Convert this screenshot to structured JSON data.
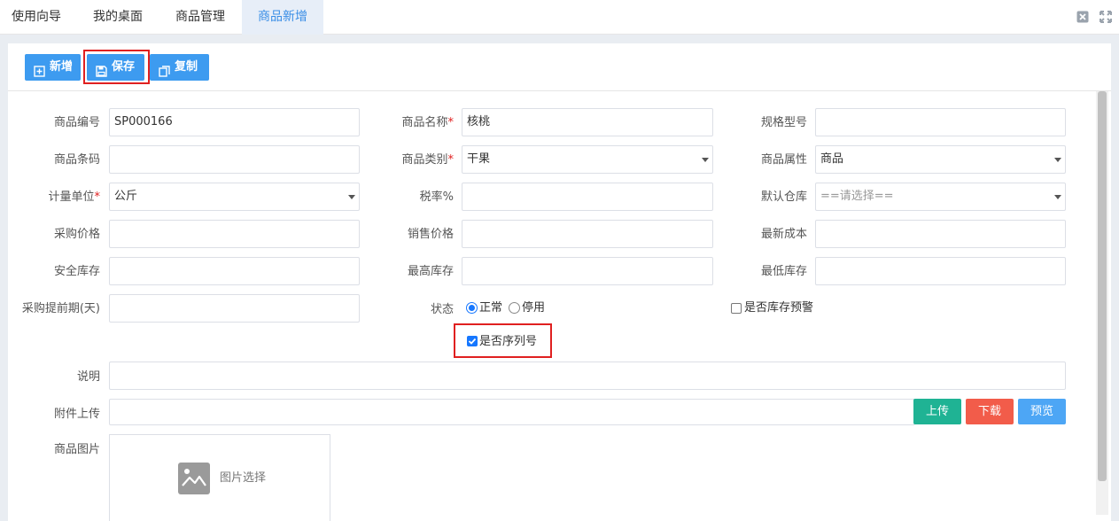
{
  "tabs": [
    {
      "label": "使用向导",
      "active": false
    },
    {
      "label": "我的桌面",
      "active": false
    },
    {
      "label": "商品管理",
      "active": false
    },
    {
      "label": "商品新增",
      "active": true
    }
  ],
  "toolbar": {
    "add_label": "新增",
    "save_label": "保存",
    "copy_label": "复制"
  },
  "form": {
    "code_label": "商品编号",
    "code_value": "SP000166",
    "name_label": "商品名称",
    "name_value": "核桃",
    "spec_label": "规格型号",
    "spec_value": "",
    "barcode_label": "商品条码",
    "barcode_value": "",
    "category_label": "商品类别",
    "category_value": "干果",
    "attr_label": "商品属性",
    "attr_value": "商品",
    "unit_label": "计量单位",
    "unit_value": "公斤",
    "tax_label": "税率%",
    "tax_value": "",
    "warehouse_label": "默认仓库",
    "warehouse_placeholder": "==请选择==",
    "purchase_price_label": "采购价格",
    "purchase_price_value": "",
    "sale_price_label": "销售价格",
    "sale_price_value": "",
    "latest_cost_label": "最新成本",
    "latest_cost_value": "",
    "safe_stock_label": "安全库存",
    "safe_stock_value": "",
    "max_stock_label": "最高库存",
    "max_stock_value": "",
    "min_stock_label": "最低库存",
    "min_stock_value": "",
    "lead_time_label": "采购提前期(天)",
    "lead_time_value": "",
    "status_label": "状态",
    "status_options": [
      "正常",
      "停用"
    ],
    "status_selected": "正常",
    "stock_warning_label": "是否库存预警",
    "stock_warning_checked": false,
    "serial_label": "是否序列号",
    "serial_checked": true,
    "desc_label": "说明",
    "desc_value": "",
    "attach_label": "附件上传",
    "attach_value": "",
    "upload_label": "上传",
    "download_label": "下载",
    "preview_label": "预览",
    "image_label": "商品图片",
    "image_select_label": "图片选择"
  },
  "colors": {
    "primary": "#3d9bf0",
    "upload": "#1fb394",
    "download": "#f25c4a",
    "preview": "#4da6f5",
    "required": "#e02020",
    "highlight": "#e02020"
  }
}
